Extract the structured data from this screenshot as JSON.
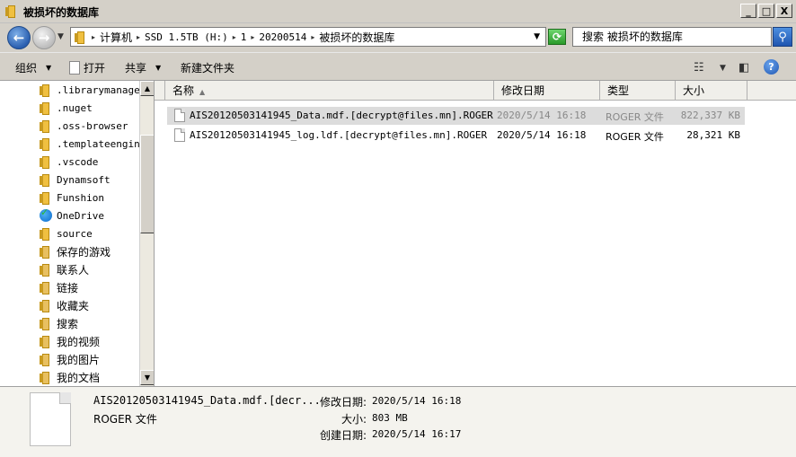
{
  "window": {
    "title": "被损坏的数据库",
    "minimize": "_",
    "maximize": "□",
    "close": "X"
  },
  "address": {
    "crumbs": [
      "计算机",
      "SSD 1.5TB (H:)",
      "1",
      "20200514",
      "被损坏的数据库"
    ],
    "search_placeholder": "搜索 被损坏的数据库"
  },
  "toolbar": {
    "organize": "组织",
    "open": "打开",
    "share": "共享",
    "new_folder": "新建文件夹"
  },
  "nav": {
    "items": [
      {
        "label": ".librarymanager",
        "icon": "folder-icon"
      },
      {
        "label": ".nuget",
        "icon": "folder-icon"
      },
      {
        "label": ".oss-browser",
        "icon": "folder-icon"
      },
      {
        "label": ".templateengine",
        "icon": "folder-icon"
      },
      {
        "label": ".vscode",
        "icon": "folder-icon"
      },
      {
        "label": "Dynamsoft",
        "icon": "folder-icon"
      },
      {
        "label": "Funshion",
        "icon": "folder-icon"
      },
      {
        "label": "OneDrive",
        "icon": "onedrive-icon"
      },
      {
        "label": "source",
        "icon": "folder-icon"
      },
      {
        "label": "保存的游戏",
        "icon": "saved-games-icon"
      },
      {
        "label": "联系人",
        "icon": "contacts-icon"
      },
      {
        "label": "链接",
        "icon": "links-icon"
      },
      {
        "label": "收藏夹",
        "icon": "favorites-icon"
      },
      {
        "label": "搜索",
        "icon": "searches-icon"
      },
      {
        "label": "我的视频",
        "icon": "videos-icon"
      },
      {
        "label": "我的图片",
        "icon": "pictures-icon"
      },
      {
        "label": "我的文档",
        "icon": "documents-icon"
      }
    ]
  },
  "columns": {
    "name": "名称",
    "modified": "修改日期",
    "type": "类型",
    "size": "大小"
  },
  "files": [
    {
      "name": "AIS20120503141945_Data.mdf.[decrypt@files.mn].ROGER",
      "modified": "2020/5/14 16:18",
      "type": "ROGER 文件",
      "size": "822,337 KB",
      "selected": true
    },
    {
      "name": "AIS20120503141945_log.ldf.[decrypt@files.mn].ROGER",
      "modified": "2020/5/14 16:18",
      "type": "ROGER 文件",
      "size": "28,321 KB",
      "selected": false
    }
  ],
  "details": {
    "filename": "AIS20120503141945_Data.mdf.[decr...",
    "filetype": "ROGER 文件",
    "modified_label": "修改日期:",
    "modified_value": "2020/5/14 16:18",
    "size_label": "大小:",
    "size_value": "803 MB",
    "created_label": "创建日期:",
    "created_value": "2020/5/14 16:17"
  }
}
